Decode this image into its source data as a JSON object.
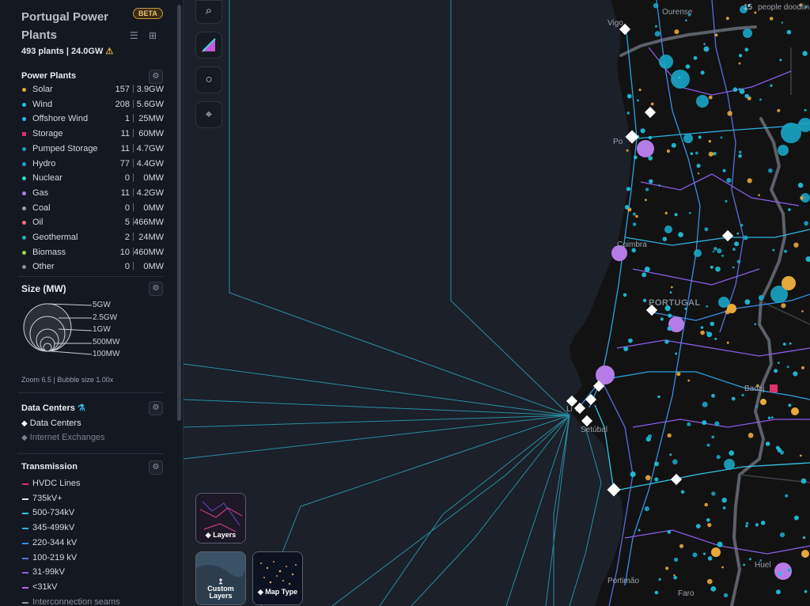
{
  "sidebar": {
    "title": "Portugal Power Plants",
    "beta": "BETA",
    "summary": "493 plants | 24.0GW",
    "plants_header": "Power Plants",
    "plant_types": [
      {
        "name": "Solar",
        "count": "157",
        "capacity": "3.9GW",
        "color": "#e8a93a",
        "shape": "dot"
      },
      {
        "name": "Wind",
        "count": "208",
        "capacity": "5.6GW",
        "color": "#22c4e0",
        "shape": "dot"
      },
      {
        "name": "Offshore Wind",
        "count": "1",
        "capacity": "25MW",
        "color": "#31b6e8",
        "shape": "dot"
      },
      {
        "name": "Storage",
        "count": "11",
        "capacity": "60MW",
        "color": "#e0306a",
        "shape": "square"
      },
      {
        "name": "Pumped Storage",
        "count": "11",
        "capacity": "4.7GW",
        "color": "#1f99b3",
        "shape": "dot"
      },
      {
        "name": "Hydro",
        "count": "77",
        "capacity": "4.4GW",
        "color": "#1aa6c6",
        "shape": "dot"
      },
      {
        "name": "Nuclear",
        "count": "0",
        "capacity": "0MW",
        "color": "#2fe0c2",
        "shape": "dot"
      },
      {
        "name": "Gas",
        "count": "11",
        "capacity": "4.2GW",
        "color": "#b57ce8",
        "shape": "dot"
      },
      {
        "name": "Coal",
        "count": "0",
        "capacity": "0MW",
        "color": "#9aa0a8",
        "shape": "dot"
      },
      {
        "name": "Oil",
        "count": "5",
        "capacity": "466MW",
        "color": "#ef6e7e",
        "shape": "dot"
      },
      {
        "name": "Geothermal",
        "count": "2",
        "capacity": "24MW",
        "color": "#1fb3a8",
        "shape": "dot"
      },
      {
        "name": "Biomass",
        "count": "10",
        "capacity": "460MW",
        "color": "#9bd64a",
        "shape": "dot"
      },
      {
        "name": "Other",
        "count": "0",
        "capacity": "0MW",
        "color": "#8a909a",
        "shape": "dot"
      }
    ],
    "size_header": "Size (MW)",
    "size_labels": [
      "5GW",
      "2.5GW",
      "1GW",
      "500MW",
      "100MW"
    ],
    "zoom_info": "Zoom 6.5 | Bubble size 1.00x",
    "dc_header": "Data Centers",
    "dc_items": [
      {
        "label": "Data Centers",
        "active": true
      },
      {
        "label": "Internet Exchanges",
        "active": false
      }
    ],
    "tx_header": "Transmission",
    "tx_items": [
      {
        "label": "HVDC Lines",
        "color": "#e0306a"
      },
      {
        "label": "735kV+",
        "color": "#e6e6e6"
      },
      {
        "label": "500-734kV",
        "color": "#35c7e6"
      },
      {
        "label": "345-499kV",
        "color": "#2cb3e0"
      },
      {
        "label": "220-344 kV",
        "color": "#3a8ee6"
      },
      {
        "label": "100-219 kV",
        "color": "#5a6ee0"
      },
      {
        "label": "31-99kV",
        "color": "#8a5ee6"
      },
      {
        "label": "<31kV",
        "color": "#b46ae8"
      },
      {
        "label": "Interconnection seams",
        "color": "#8a909a"
      }
    ]
  },
  "tiles": {
    "layers": "Layers",
    "custom_layers": "Custom Layers",
    "map_type": "Map Type"
  },
  "map": {
    "labels": {
      "ourense": "Ourense",
      "vigo": "Vigo",
      "porto": "Po",
      "coimbra": "Coimbra",
      "portugal": "PORTUGAL",
      "lisbon": "Li",
      "setubal": "Setúbal",
      "badajoz": "Badaj",
      "portimao": "Portimão",
      "faro": "Faro",
      "huelva": "Huel",
      "people": "people doodlin",
      "count15": "15"
    }
  },
  "colors": {
    "accent_wind": "#22c4e0",
    "accent_solar": "#e8a93a",
    "accent_gas": "#b57ce8",
    "datacenter": "#ffffff"
  }
}
